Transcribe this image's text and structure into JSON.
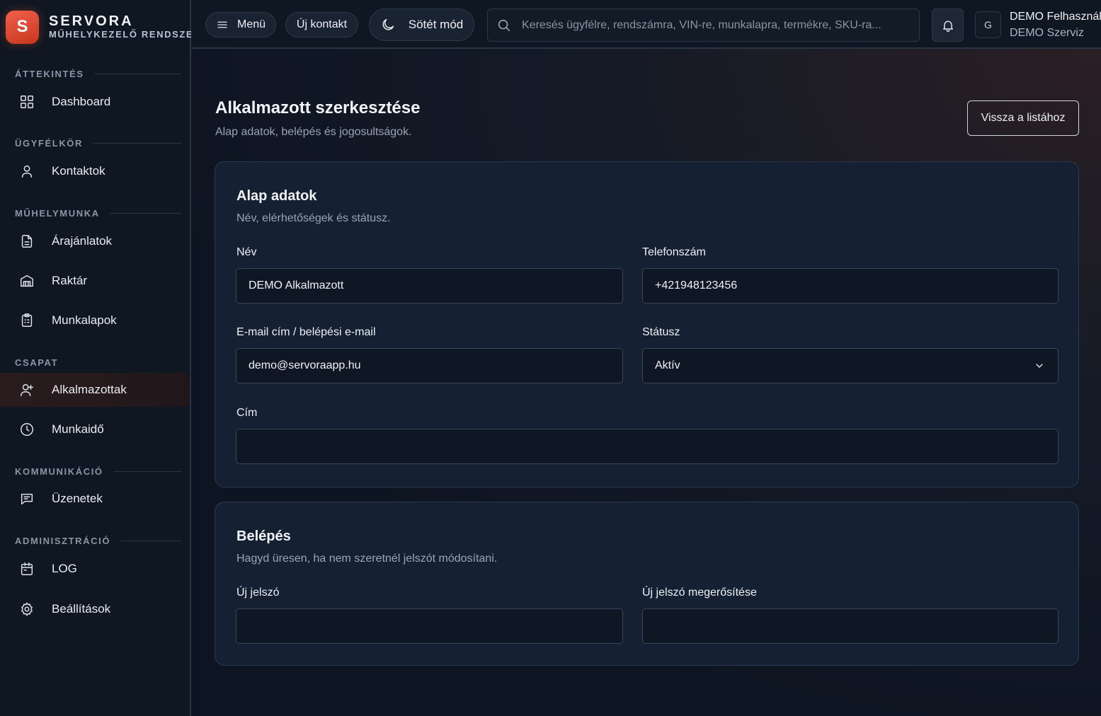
{
  "brand": {
    "logo_letter": "S",
    "name": "SERVORA",
    "subtitle": "MŰHELYKEZELŐ RENDSZER"
  },
  "sidebar": {
    "sections": [
      {
        "label": "ÁTTEKINTÉS",
        "items": [
          {
            "label": "Dashboard",
            "icon": "grid-icon"
          }
        ]
      },
      {
        "label": "ÜGYFÉLKÖR",
        "items": [
          {
            "label": "Kontaktok",
            "icon": "user-icon"
          }
        ]
      },
      {
        "label": "MŰHELYMUNKA",
        "items": [
          {
            "label": "Árajánlatok",
            "icon": "document-icon"
          },
          {
            "label": "Raktár",
            "icon": "warehouse-icon"
          },
          {
            "label": "Munkalapok",
            "icon": "clipboard-icon"
          }
        ]
      },
      {
        "label": "CSAPAT",
        "items": [
          {
            "label": "Alkalmazottak",
            "icon": "user-plus-icon",
            "active": true
          },
          {
            "label": "Munkaidő",
            "icon": "clock-icon"
          }
        ]
      },
      {
        "label": "KOMMUNIKÁCIÓ",
        "items": [
          {
            "label": "Üzenetek",
            "icon": "message-icon"
          }
        ]
      },
      {
        "label": "ADMINISZTRÁCIÓ",
        "items": [
          {
            "label": "LOG",
            "icon": "calendar-icon"
          },
          {
            "label": "Beállítások",
            "icon": "gear-icon"
          }
        ]
      }
    ]
  },
  "topbar": {
    "menu_label": "Menü",
    "new_contact_label": "Új kontakt",
    "dark_mode_label": "Sötét mód",
    "search_placeholder": "Keresés ügyfélre, rendszámra, VIN-re, munkalapra, termékre, SKU-ra...",
    "avatar_letter": "G",
    "user_name": "DEMO Felhasználó",
    "user_org": "DEMO Szerviz"
  },
  "page": {
    "title": "Alkalmazott szerkesztése",
    "subtitle": "Alap adatok, belépés és jogosultságok.",
    "back_label": "Vissza a listához"
  },
  "basic": {
    "title": "Alap adatok",
    "subtitle": "Név, elérhetőségek és státusz.",
    "name_label": "Név",
    "name_value": "DEMO Alkalmazott",
    "phone_label": "Telefonszám",
    "phone_value": "+421948123456",
    "email_label": "E-mail cím / belépési e-mail",
    "email_value": "demo@servoraapp.hu",
    "status_label": "Státusz",
    "status_value": "Aktív",
    "address_label": "Cím",
    "address_value": ""
  },
  "login": {
    "title": "Belépés",
    "subtitle": "Hagyd üresen, ha nem szeretnél jelszót módosítani.",
    "new_password_label": "Új jelszó",
    "confirm_password_label": "Új jelszó megerősítése"
  }
}
